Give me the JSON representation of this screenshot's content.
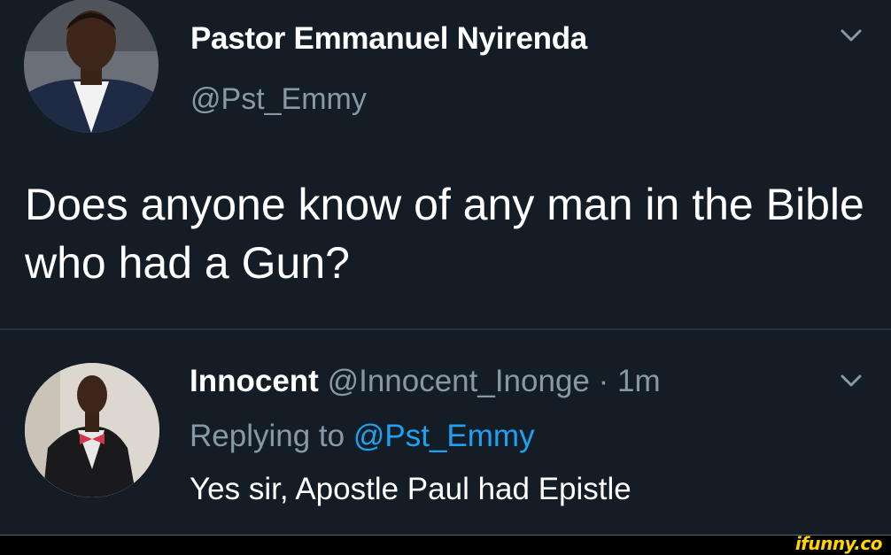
{
  "main_tweet": {
    "display_name": "Pastor Emmanuel Nyirenda",
    "handle": "@Pst_Emmy",
    "text": "Does anyone know of any man in the Bible who had a Gun?",
    "avatar_icon": "profile-photo-man-suit"
  },
  "reply_tweet": {
    "display_name": "Innocent",
    "meta": "@Innocent_Inonge · 1m",
    "replying_prefix": "Replying to",
    "replying_mention": "@Pst_Emmy",
    "text": "Yes sir, Apostle Paul had Epistle",
    "avatar_icon": "profile-photo-man-bowtie"
  },
  "watermark": "ifunny.co",
  "colors": {
    "background": "#141d26",
    "secondary_text": "#8899a6",
    "link": "#1da1f2",
    "watermark": "#ffd400"
  }
}
